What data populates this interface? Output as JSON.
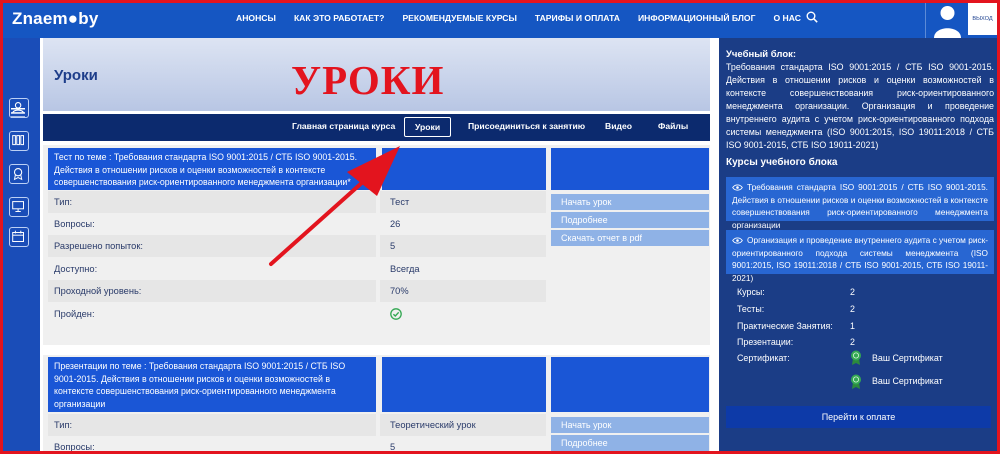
{
  "header": {
    "logo": "Znaem●by",
    "nav": [
      "АНОНСЫ",
      "КАК ЭТО РАБОТАЕТ?",
      "РЕКОМЕНДУЕМЫЕ КУРСЫ",
      "ТАРИФЫ И ОПЛАТА",
      "ИНФОРМАЦИОННЫЙ БЛОГ",
      "О НАС"
    ],
    "logout_label": "ВЫХОД"
  },
  "page": {
    "title": "Уроки",
    "overlay_title": "УРОКИ"
  },
  "tabs": [
    "Главная страница курса",
    "Уроки",
    "Присоединиться к занятию",
    "Видео",
    "Файлы"
  ],
  "lessons": [
    {
      "title": "Тест по теме : Требования стандарта ISO 9001:2015 / СТБ ISO 9001-2015. Действия в отношении рисков и оценки возможностей в контексте совершенствования риск-ориентированного менеджмента организации*",
      "rows": [
        {
          "label": "Тип:",
          "value": "Тест"
        },
        {
          "label": "Вопросы:",
          "value": "26"
        },
        {
          "label": "Разрешено попыток:",
          "value": "5"
        },
        {
          "label": "Доступно:",
          "value": "Всегда"
        },
        {
          "label": "Проходной уровень:",
          "value": "70%"
        },
        {
          "label": "Пройден:",
          "value": ""
        }
      ],
      "actions": [
        "Начать урок",
        "Подробнее",
        "Скачать отчет в pdf"
      ]
    },
    {
      "title": "Презентации по теме : Требования стандарта ISO 9001:2015 / СТБ ISO 9001-2015. Действия в отношении рисков и оценки возможностей в контексте совершенствования риск-ориентированного менеджмента организации",
      "rows": [
        {
          "label": "Тип:",
          "value": "Теоретический урок"
        },
        {
          "label": "Вопросы:",
          "value": "5"
        }
      ],
      "actions": [
        "Начать урок",
        "Подробнее"
      ]
    }
  ],
  "sidebar": {
    "block_label": "Учебный блок:",
    "block_text": "Требования стандарта ISO 9001:2015 / СТБ ISO 9001-2015. Действия в отношении рисков и оценки возможностей в контексте совершенствования риск-ориентированного менеджмента организации. Организация и проведение внутреннего аудита с учетом риск-ориентированного подхода системы менеджмента (ISO 9001:2015, ISO 19011:2018 / СТБ ISO 9001-2015, СТБ ISO 19011-2021)",
    "courses_heading": "Курсы учебного блока",
    "courses": [
      "Требования стандарта ISO 9001:2015 / СТБ ISO 9001-2015. Действия в отношении рисков и оценки возможностей в контексте совершенствования риск-ориентированного менеджмента организации",
      "Организация и проведение внутреннего аудита с учетом риск-ориентированного подхода системы менеджмента (ISO 9001:2015, ISO 19011:2018 / СТБ ISO 9001-2015, СТБ ISO 19011-2021)"
    ],
    "stats": [
      {
        "label": "Курсы:",
        "value": "2"
      },
      {
        "label": "Тесты:",
        "value": "2"
      },
      {
        "label": "Практические Занятия:",
        "value": "1"
      },
      {
        "label": "Презентации:",
        "value": "2"
      }
    ],
    "certificate_label": "Сертификат:",
    "certificates": [
      "Ваш Сертификат",
      "Ваш Сертификат"
    ],
    "pay_button": "Перейти к оплате"
  },
  "colors": {
    "brand_blue": "#1556c2",
    "accent_red": "#e3141e",
    "panel_navy": "#1b3d86",
    "success_green": "#34a853"
  },
  "icons": {
    "search": "search-icon",
    "user": "user-avatar-icon",
    "menu": "hamburger-menu-icon",
    "passed": "check-circle-icon",
    "certificate": "medal-icon",
    "course": "eye-icon"
  }
}
